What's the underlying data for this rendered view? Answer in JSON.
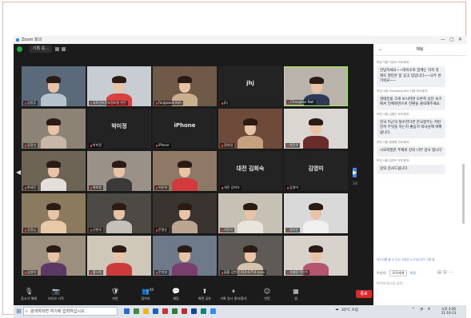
{
  "window": {
    "title": "Zoom 회의",
    "view_label": "기록 중..."
  },
  "navigation": {
    "left_arrow": "◀",
    "right_arrow": "▶",
    "page": "1/2"
  },
  "participants": [
    {
      "name": "김원훈",
      "type": "video"
    },
    {
      "name": "국토안보정보정보원 한민",
      "type": "video"
    },
    {
      "name": "Fangwook Kim",
      "type": "video"
    },
    {
      "name": "jhj",
      "type": "name",
      "center": "jhj"
    },
    {
      "name": "Changhee Nah",
      "type": "video",
      "active": true
    },
    {
      "name": "강정선",
      "type": "video"
    },
    {
      "name": "박미정",
      "type": "name",
      "center": "박미정"
    },
    {
      "name": "iPhone",
      "type": "name",
      "center": "iPhone"
    },
    {
      "name": "정대영",
      "type": "video"
    },
    {
      "name": "하진우",
      "type": "video"
    },
    {
      "name": "한세진",
      "type": "video"
    },
    {
      "name": "최희원",
      "type": "video"
    },
    {
      "name": "이은희",
      "type": "video"
    },
    {
      "name": "대전 김희숙",
      "type": "name",
      "center": "대전 김희숙"
    },
    {
      "name": "김영미",
      "type": "name",
      "center": "김영미"
    },
    {
      "name": "강정님",
      "type": "video"
    },
    {
      "name": "신현숙",
      "type": "video"
    },
    {
      "name": "문명순",
      "type": "video"
    },
    {
      "name": "이은지",
      "type": "video"
    },
    {
      "name": "정기은",
      "type": "video"
    },
    {
      "name": "김영미",
      "type": "video"
    },
    {
      "name": "황나희",
      "type": "video"
    },
    {
      "name": "문미영",
      "type": "video"
    },
    {
      "name": "불황 김천정 010-6754-xxxx",
      "type": "video"
    },
    {
      "name": "지혜림 박진수",
      "type": "video"
    }
  ],
  "toolbar": {
    "items": [
      {
        "label": "음소거 해제",
        "icon": "🎙"
      },
      {
        "label": "비디오 시작",
        "icon": "📷"
      },
      {
        "label": "보안",
        "icon": "🛡"
      },
      {
        "label": "참가자",
        "icon": "👥",
        "count": "46"
      },
      {
        "label": "채팅",
        "icon": "💬"
      },
      {
        "label": "화면 공유",
        "icon": "⬆"
      },
      {
        "label": "기록 일시 중지/중지",
        "icon": "⏸"
      },
      {
        "label": "반응",
        "icon": "☺"
      },
      {
        "label": "앱",
        "icon": "▦"
      }
    ],
    "end_label": "종료"
  },
  "chat": {
    "title": "채팅",
    "messages": [
      {
        "sender": "보낸 사람 다은이 모두에게:",
        "text": "안녕하세요~~데이오로 함께는 하지 못해도 열띤은 참 응고 업입니다~~모두 반가워요~~"
      },
      {
        "sender": "보낸 사람 Geejoong Kim 다음 모두에게:",
        "text": "권태진을 크게 보시려면 오른쪽 상단 보기 에서 전체화면으로 전환을 클릭해주세요."
      },
      {
        "sender": "보낸 사람 김홍순 모두에게:",
        "text": "한국 미군의 철수한다면 한국정부는 저런 먼저 무엇을 하는지 좋음지 박사님께 여쭤봅니다."
      },
      {
        "sender": "보낸 사람 정희원 모두에게:",
        "text": "시의적절한 주제로 강의 너무 감사 합니다"
      },
      {
        "sender": "보낸 사람 김란오 모두에게:",
        "text": "강의 감사드립니다."
      }
    ],
    "note": "메시지를 볼 수 있는 사람은 누구입니까? 기록 중",
    "recipient_label": "수신자:",
    "recipient_value": "모두에게",
    "recipient_badge": "파일",
    "input_placeholder": "여기에 메시지 입력..."
  },
  "taskbar": {
    "search_placeholder": "검색하려면 여기에 입력하십시오.",
    "weather": "20°C 흐림",
    "lang": "A",
    "time": "오후 3:36",
    "date": "21-10-13"
  }
}
